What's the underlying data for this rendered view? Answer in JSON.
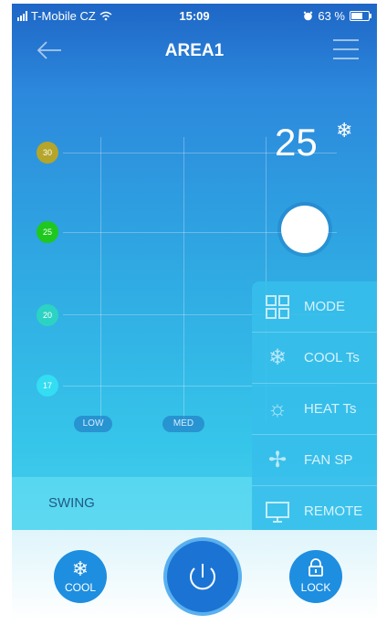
{
  "status_bar": {
    "carrier": "T-Mobile CZ",
    "time": "15:09",
    "battery": "63 %",
    "battery_level": 0.63
  },
  "nav": {
    "title": "AREA1",
    "back_icon": "arrow-left-icon",
    "menu_icon": "hamburger-menu-icon"
  },
  "temperature": {
    "value": "25",
    "mode_icon": "snowflake-icon"
  },
  "temp_scale": [
    {
      "label": "30",
      "color": "#b5a52a"
    },
    {
      "label": "25",
      "color": "#1ec81e"
    },
    {
      "label": "20",
      "color": "#2cd3c2"
    },
    {
      "label": "17",
      "color": "#33ddf2"
    }
  ],
  "fan_speeds": [
    "LOW",
    "MED"
  ],
  "swing": {
    "label": "SWING"
  },
  "popup_menu": [
    {
      "label": "MODE",
      "icon": "grid-icon"
    },
    {
      "label": "COOL Ts",
      "icon": "snowflake-icon"
    },
    {
      "label": "HEAT Ts",
      "icon": "sun-icon"
    },
    {
      "label": "FAN SP",
      "icon": "fan-icon"
    },
    {
      "label": "REMOTE",
      "icon": "monitor-icon"
    }
  ],
  "bottom": {
    "cool": {
      "label": "COOL",
      "icon": "snowflake-icon"
    },
    "power": {
      "icon": "power-icon"
    },
    "lock": {
      "label": "LOCK",
      "icon": "lock-icon"
    }
  }
}
